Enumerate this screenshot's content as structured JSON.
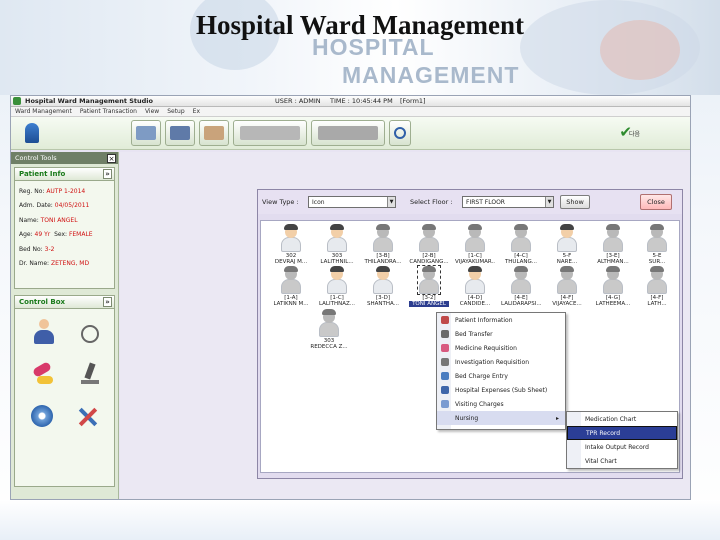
{
  "slide": {
    "title": "Hospital Ward Management",
    "watermark_line1": "HOSPITAL",
    "watermark_line2": "MANAGEMENT"
  },
  "app": {
    "title": "Hospital Ward Management Studio",
    "user": "USER : ADMIN",
    "time": "TIME : 10:45:44 PM",
    "form": "[Form1]",
    "menu": [
      "Ward Management",
      "Patient Transaction",
      "View",
      "Setup",
      "Ex"
    ],
    "toolbar_check_label": "다음"
  },
  "control_tools": {
    "header": "Control Tools",
    "close": "×"
  },
  "patient_info": {
    "header": "Patient Info",
    "chevron": "»",
    "reg_no_label": "Reg. No: ",
    "reg_no": "AUTP 1-2014",
    "adm_date_label": "Adm. Date: ",
    "adm_date": "04/05/2011",
    "name_label": "Name: ",
    "name": "TONI ANGEL",
    "age_label": "Age: ",
    "age": "49 Yr",
    "sex_label": "Sex: ",
    "sex": "FEMALE",
    "bed_no_label": "Bed No: ",
    "bed_no": "3-2",
    "dr_name_label": "Dr. Name: ",
    "dr_name": "ZETENG, MD"
  },
  "control_box": {
    "header": "Control Box",
    "chevron": "»",
    "icons": [
      "doctor-icon",
      "wheelchair-icon",
      "medicine-icon",
      "microscope-icon",
      "dvd-icon",
      "tools-icon"
    ]
  },
  "ward_view": {
    "view_type_label": "View Type :",
    "view_type_value": "Icon",
    "select_floor_label": "Select Floor :",
    "select_floor_value": "FIRST FLOOR",
    "show_button": "Show",
    "close_button": "Close"
  },
  "patients_row1": [
    {
      "bed": "302",
      "name": "DEVRAJ M..."
    },
    {
      "bed": "303",
      "name": "LALITHNIL..."
    },
    {
      "bed": "[3-B]",
      "name": "THILANDRA..."
    },
    {
      "bed": "[2-B]",
      "name": "CANDIGANG..."
    },
    {
      "bed": "[1-C]",
      "name": "VIJAYAKUMAR..."
    },
    {
      "bed": "[4-C]",
      "name": "THULANG..."
    },
    {
      "bed": "5-F",
      "name": "NARE..."
    },
    {
      "bed": "[3-E]",
      "name": "ALTHMAN..."
    },
    {
      "bed": "5-E",
      "name": "SUR..."
    }
  ],
  "patients_row2": [
    {
      "bed": "[1-A]",
      "name": "LATIKNN M..."
    },
    {
      "bed": "[1-C]",
      "name": "LALITHNAZ..."
    },
    {
      "bed": "[3-D]",
      "name": "SHANTHA..."
    },
    {
      "bed": "[3-2]",
      "name": "TONI ANGEL"
    },
    {
      "bed": "[4-D]",
      "name": "CANDIDE..."
    },
    {
      "bed": "[4-E]",
      "name": "LALIDARAPSI..."
    },
    {
      "bed": "[4-F]",
      "name": "VIJAYACE..."
    },
    {
      "bed": "[4-G]",
      "name": "LATHEEMA..."
    },
    {
      "bed": "[4-F]",
      "name": "LATH..."
    }
  ],
  "patients_row3": [
    {
      "bed": "303",
      "name": "REDECCA Z..."
    }
  ],
  "context_menu": {
    "items": [
      "Patient Information",
      "Bed Transfer",
      "Medicine Requisition",
      "Investigation Requisition",
      "Bed Charge Entry",
      "Hospital Expenses (Sub Sheet)",
      "Visiting Charges",
      "Nursing"
    ],
    "nursing_arrow": "▸"
  },
  "nursing_submenu": {
    "items": [
      "Medication Chart",
      "TPR Record",
      "Intake Output Record",
      "Vital Chart"
    ],
    "selected": "TPR Record"
  },
  "colors": {
    "accent_green": "#1a7a1a",
    "value_red": "#d01010",
    "menu_selected": "#2b3e96"
  }
}
